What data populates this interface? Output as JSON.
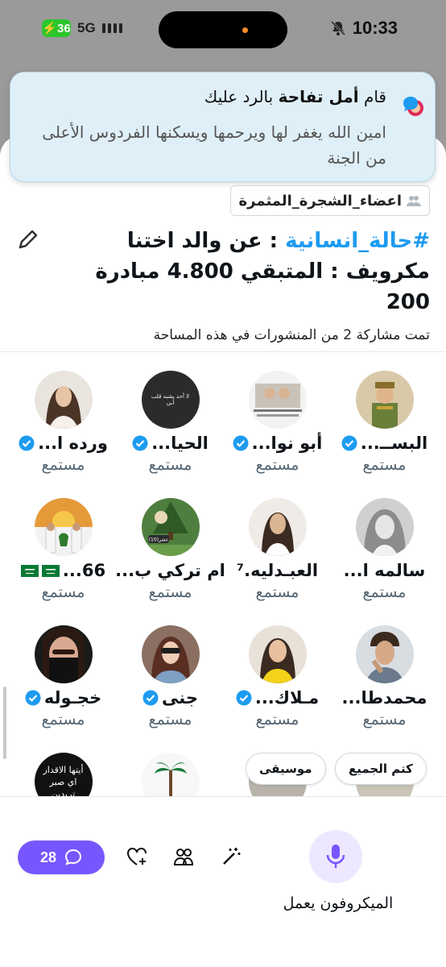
{
  "status_bar": {
    "battery": "36",
    "network": "5G",
    "time": "10:33"
  },
  "notification": {
    "action_prefix": "قام",
    "user": "أمل تفاحة",
    "action_suffix": "بالرد عليك",
    "message": "امين الله يغفر لها ويرحمها ويسكنها الفردوس الأعلى من الجنة"
  },
  "space": {
    "community": "اعضاء_الشجرة_المثمرة",
    "title_hashtag": "#حالة_انسانية",
    "title_rest": ": عن والد اختنا مكرويف   : المتبقي 4.800 مبادرة 200",
    "shared_posts": "تمت مشاركة 2 من المنشورات في هذه المساحة"
  },
  "listeners": [
    {
      "name": "البســ...",
      "role": "مستمع",
      "verified": true
    },
    {
      "name": "أبو نوا...",
      "role": "مستمع",
      "verified": true
    },
    {
      "name": "الحيا...",
      "role": "مستمع",
      "verified": true
    },
    {
      "name": "ورده ا...",
      "role": "مستمع",
      "verified": true
    },
    {
      "name": "سالمه  ا...",
      "role": "مستمع",
      "verified": false
    },
    {
      "name": "العبـدليه.⁷",
      "role": "مستمع",
      "verified": false
    },
    {
      "name": "ام تركي ب...",
      "role": "مستمع",
      "verified": false
    },
    {
      "name": "66...",
      "role": "مستمع",
      "verified": false,
      "flags": true
    },
    {
      "name": "محمدطا...",
      "role": "مستمع",
      "verified": false
    },
    {
      "name": "مـلاك...",
      "role": "مستمع",
      "verified": true
    },
    {
      "name": "جنى",
      "role": "مستمع",
      "verified": true
    },
    {
      "name": "خجـوله",
      "role": "مستمع",
      "verified": true
    },
    {
      "name": "",
      "role": "",
      "verified": false
    },
    {
      "name": "",
      "role": "",
      "verified": false
    },
    {
      "name": "",
      "role": "",
      "verified": false
    },
    {
      "name": "",
      "role": "",
      "verified": false
    }
  ],
  "avatar_text": {
    "a3": "لا أحد يشبه قلب أبي",
    "a7": "عشر(10)",
    "a16": "أيتها الاقدار اي صبر تريدين"
  },
  "controls": {
    "mute_all": "كتم الجميع",
    "music": "موسيقى",
    "comments_count": "28",
    "mic_label": "الميكروفون يعمل"
  },
  "colors": {
    "accent": "#7856ff",
    "link": "#1d9bf0",
    "verified": "#1d9bf0"
  }
}
